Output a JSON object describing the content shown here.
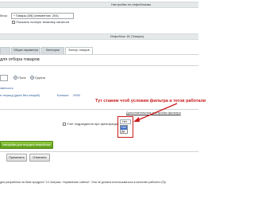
{
  "top_bar": {
    "title": "Настройки по инфоблокам"
  },
  "block_row": {
    "label": "блок:",
    "select_value": "* Товары [59] (элементов: 204)",
    "show_all_label": "Показать полную тематику каталога"
  },
  "iblock_bar": {
    "title": "Инфоблок 18 (Товары)"
  },
  "tabs": [
    {
      "label": "",
      "active": false
    },
    {
      "label": "Общие параметры",
      "active": false
    },
    {
      "label": "Категории",
      "active": false
    },
    {
      "label": "Фильтр товаров",
      "active": true
    }
  ],
  "section_title": "для отбора товаров",
  "filter_row": {
    "select_value": "",
    "field_label": "Поле",
    "group_label": "Группа"
  },
  "text_ovienost": "хвеность",
  "period_row": {
    "label": "е период (дата без секций)",
    "value_label": "Больше",
    "value": "2000"
  },
  "callout": {
    "text": "Тут ставим чтоб условия фильтра и тегов работали"
  },
  "extra_bar": {
    "title": "Дополнительные настройки фильтра"
  },
  "subsections": {
    "checkbox_label": "Учет подразделов при фильтрации:",
    "select_value": "Нет",
    "options": [
      "Нет",
      "Да"
    ],
    "selected_index": 0
  },
  "green_button": {
    "label": "настройки для текущего инфоблока"
  },
  "bottom_buttons": {
    "apply": "Применить",
    "cancel": "Отменить"
  },
  "footer": {
    "text": "для разработки на базе продукта \"1С-Битрикс: Управление сайтом\". Она не должна использоваться в качестве рабочего (Пр"
  },
  "colors": {
    "bar": "#e6e9ea",
    "accent_red": "#cc1a1a",
    "green_button": "#6aa625",
    "selection_blue": "#3f72c8"
  }
}
